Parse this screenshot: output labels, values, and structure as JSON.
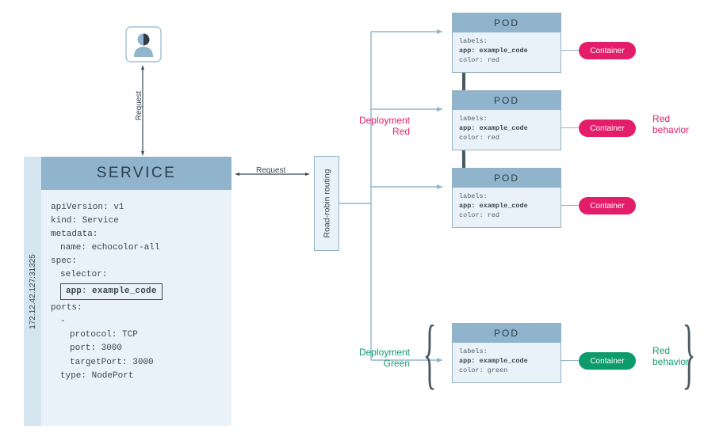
{
  "user": {
    "name": "user-icon"
  },
  "arrows": {
    "request": "Request"
  },
  "service": {
    "ip": "172.12.42.127:31325",
    "title": "SERVICE",
    "yaml": {
      "apiVersion": "apiVersion: v1",
      "kind": "kind: Service",
      "metadata": "metadata:",
      "name": "name: echocolor-all",
      "spec": "spec:",
      "selector": "selector:",
      "selectorKey": "app",
      "selectorVal": "example_code",
      "ports": "ports:",
      "dash": "-",
      "protocol": "protocol: TCP",
      "port": "port: 3000",
      "targetPort": "targetPort: 3000",
      "type": "type: NodePort"
    }
  },
  "router": {
    "label": "Road-robin routing"
  },
  "deployments": {
    "red": "Deployment Red",
    "green": "Deployment Green"
  },
  "pod": {
    "header": "POD",
    "labels": "labels:",
    "appLine": "app: example_code",
    "colorRed": "color: red",
    "colorGreen": "color: green"
  },
  "container": {
    "label": "Container"
  },
  "behavior": {
    "red": "Red behavior",
    "green": "Red behavior"
  }
}
